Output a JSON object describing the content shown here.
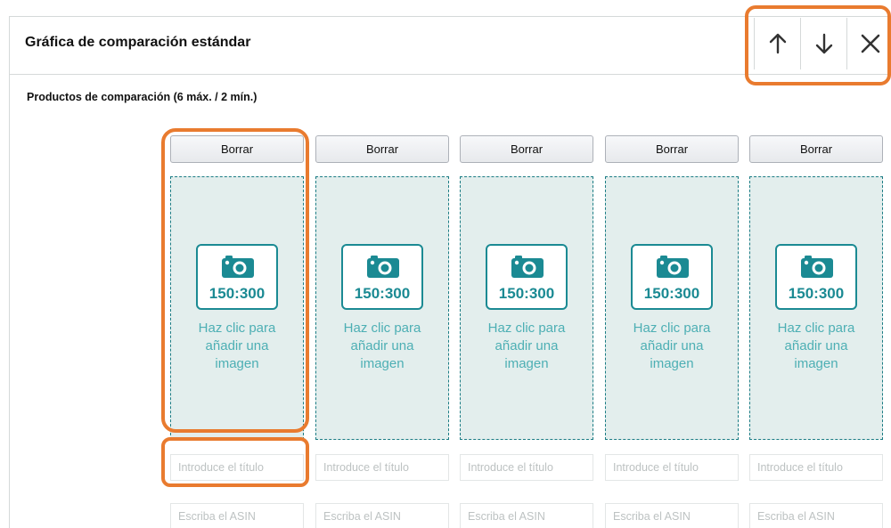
{
  "module": {
    "title": "Gráfica de comparación estándar",
    "section_label": "Productos de comparación (6 máx. / 2 mín.)"
  },
  "actions": {
    "move_up_icon": "arrow-up-icon",
    "move_down_icon": "arrow-down-icon",
    "close_icon": "close-icon"
  },
  "columns": [
    {
      "delete_label": "Borrar",
      "ratio": "150:300",
      "hint": [
        "Haz clic para",
        "añadir una",
        "imagen"
      ],
      "title_placeholder": "Introduce el título",
      "asin_placeholder": "Escriba el ASIN"
    },
    {
      "delete_label": "Borrar",
      "ratio": "150:300",
      "hint": [
        "Haz clic para",
        "añadir una",
        "imagen"
      ],
      "title_placeholder": "Introduce el título",
      "asin_placeholder": "Escriba el ASIN"
    },
    {
      "delete_label": "Borrar",
      "ratio": "150:300",
      "hint": [
        "Haz clic para",
        "añadir una",
        "imagen"
      ],
      "title_placeholder": "Introduce el título",
      "asin_placeholder": "Escriba el ASIN"
    },
    {
      "delete_label": "Borrar",
      "ratio": "150:300",
      "hint": [
        "Haz clic para",
        "añadir una",
        "imagen"
      ],
      "title_placeholder": "Introduce el título",
      "asin_placeholder": "Escriba el ASIN"
    },
    {
      "delete_label": "Borrar",
      "ratio": "150:300",
      "hint": [
        "Haz clic para",
        "añadir una",
        "imagen"
      ],
      "title_placeholder": "Introduce el título",
      "asin_placeholder": "Escriba el ASIN"
    }
  ],
  "colors": {
    "accent": "#1b8a93",
    "highlight": "#e97b2f",
    "drop_zone_bg": "#e3eeed"
  }
}
